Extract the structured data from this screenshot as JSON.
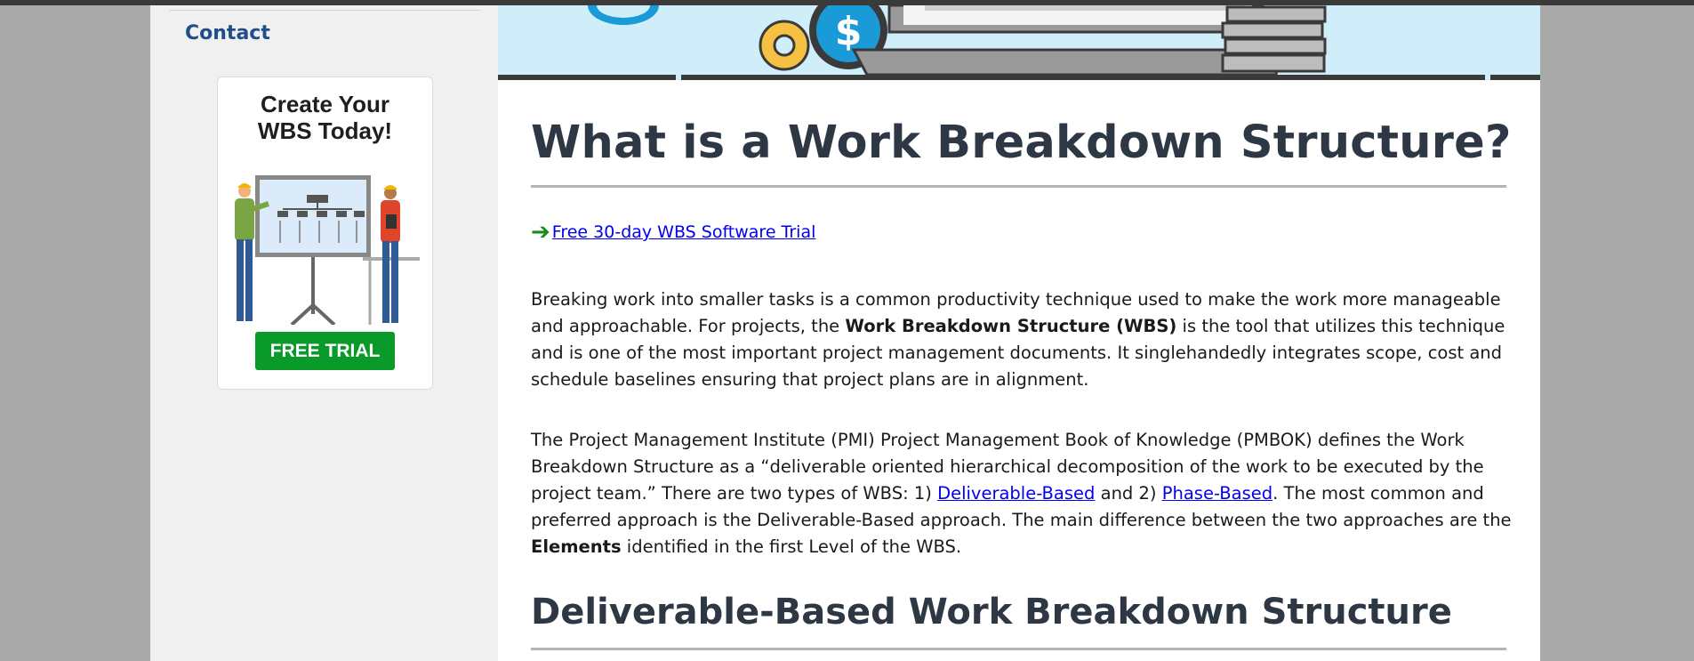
{
  "sidebar": {
    "contact_label": "Contact",
    "ad": {
      "title": "Create Your\nWBS Today!",
      "button_label": "FREE TRIAL"
    }
  },
  "main": {
    "title": "What is a Work Breakdown Structure?",
    "trial_link": "Free 30-day WBS Software Trial",
    "p1": {
      "a": "Breaking work into smaller tasks is a common productivity technique used to make the work more manageable and approachable. For projects, the ",
      "bold": "Work Breakdown Structure (WBS)",
      "b": " is the tool that utilizes this technique and is one of the most important project management documents. It singlehandedly integrates scope, cost and schedule baselines ensuring that project plans are in alignment."
    },
    "p2": {
      "a": "The Project Management Institute (PMI) Project Management Book of Knowledge (PMBOK) defines the Work Breakdown Structure as a “deliverable oriented hierarchical decomposition of the work to be executed by the project team.” There are two types of WBS: 1) ",
      "link1": "Deliverable-Based",
      "b": " and 2) ",
      "link2": "Phase-Based",
      "c": ". The most common and preferred approach is the Deliverable-Based approach. The main difference between the two approaches are the ",
      "bold": "Elements",
      "d": " identified in the first Level of the WBS."
    },
    "subtitle": "Deliverable-Based Work Breakdown Structure"
  },
  "colors": {
    "link": "#0000ee",
    "heading": "#2e3845",
    "button": "#0a9a2a",
    "sidebar_bg": "#f0f0f0",
    "hero_bg": "#cfeefa",
    "hero_accent": "#1a9ad6"
  },
  "icons": {
    "hero": [
      "gear-icon",
      "dollar-coin-icon",
      "laptop-icon",
      "coin-stack-icon"
    ],
    "trial": "arrow-right-icon"
  }
}
